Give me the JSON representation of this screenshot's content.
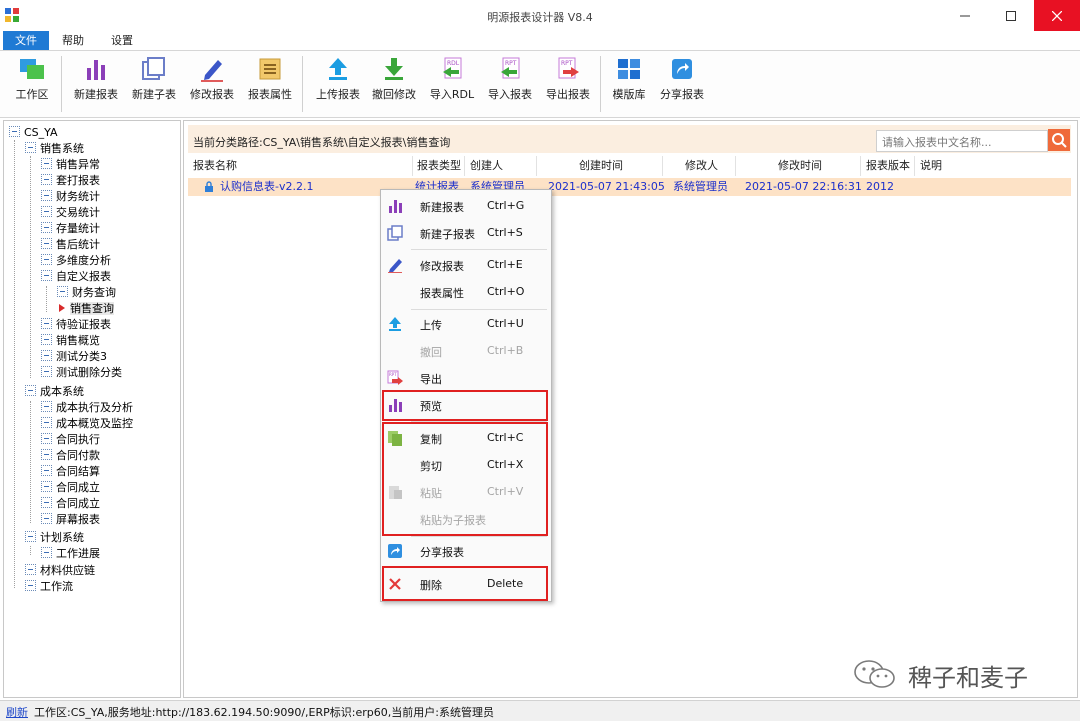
{
  "window": {
    "title": "明源报表设计器 V8.4"
  },
  "menu_tabs": [
    "文件",
    "帮助",
    "设置"
  ],
  "toolbar": {
    "workspace": "工作区",
    "new_report": "新建报表",
    "new_subreport": "新建子表",
    "edit_report": "修改报表",
    "report_props": "报表属性",
    "upload_report": "上传报表",
    "revoke_edit": "撤回修改",
    "import_rdl": "导入RDL",
    "import_report": "导入报表",
    "export_report": "导出报表",
    "template_lib": "模版库",
    "share_report": "分享报表"
  },
  "tree": {
    "root": "CS_YA",
    "sales": "销售系统",
    "sales_items": [
      "销售异常",
      "套打报表",
      "财务统计",
      "交易统计",
      "存量统计",
      "售后统计",
      "多维度分析",
      "自定义报表"
    ],
    "custom_items": [
      "财务查询",
      "销售查询"
    ],
    "sales_items2": [
      "待验证报表",
      "销售概览",
      "测试分类3",
      "测试删除分类"
    ],
    "cost": "成本系统",
    "cost_items": [
      "成本执行及分析",
      "成本概览及监控",
      "合同执行",
      "合同付款",
      "合同结算",
      "合同成立",
      "合同成立",
      "屏幕报表"
    ],
    "plan": "计划系统",
    "plan_items": [
      "工作进展"
    ],
    "supply": "材料供应链",
    "workflow": "工作流"
  },
  "path": {
    "text": "当前分类路径:CS_YA\\销售系统\\自定义报表\\销售查询"
  },
  "search": {
    "placeholder": "请输入报表中文名称..."
  },
  "table": {
    "headers": [
      "报表名称",
      "报表类型",
      "创建人",
      "创建时间",
      "修改人",
      "修改时间",
      "报表版本",
      "说明"
    ],
    "row": {
      "name": "认购信息表-v2.2.1",
      "type": "统计报表",
      "creator": "系统管理员",
      "created": "2021-05-07 21:43:05",
      "modifier": "系统管理员",
      "modified": "2021-05-07 22:16:31",
      "version": "2012",
      "note": ""
    }
  },
  "context_menu": {
    "new_report": {
      "label": "新建报表",
      "shortcut": "Ctrl+G"
    },
    "new_subreport": {
      "label": "新建子报表",
      "shortcut": "Ctrl+S"
    },
    "edit_report": {
      "label": "修改报表",
      "shortcut": "Ctrl+E"
    },
    "report_props": {
      "label": "报表属性",
      "shortcut": "Ctrl+O"
    },
    "upload": {
      "label": "上传",
      "shortcut": "Ctrl+U"
    },
    "revoke": {
      "label": "撤回",
      "shortcut": "Ctrl+B"
    },
    "export": {
      "label": "导出"
    },
    "preview": {
      "label": "预览"
    },
    "copy": {
      "label": "复制",
      "shortcut": "Ctrl+C"
    },
    "cut": {
      "label": "剪切",
      "shortcut": "Ctrl+X"
    },
    "paste": {
      "label": "粘贴",
      "shortcut": "Ctrl+V"
    },
    "paste_child": {
      "label": "粘贴为子报表"
    },
    "share": {
      "label": "分享报表"
    },
    "delete": {
      "label": "删除",
      "shortcut": "Delete"
    }
  },
  "watermark": {
    "text": "稗子和麦子"
  },
  "status": {
    "refresh": "刷新",
    "text": "工作区:CS_YA,服务地址:http://183.62.194.50:9090/,ERP标识:erp60,当前用户:系统管理员"
  },
  "colors": {
    "accent": "#1f7ad4",
    "highlight_row": "#fde2c6",
    "path_bar": "#fbeee0",
    "alert": "#e02020"
  }
}
